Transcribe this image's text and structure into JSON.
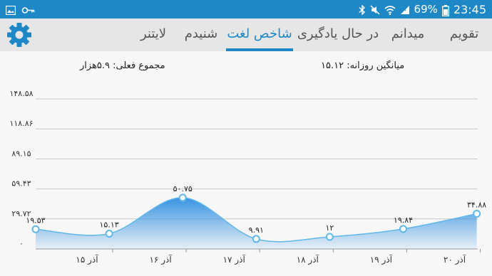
{
  "status_bar": {
    "battery": "69%",
    "time": "23:45",
    "left_icons": [
      "gallery-icon",
      "key-icon"
    ],
    "right_icons": [
      "bluetooth-icon",
      "mute-icon",
      "wifi-icon",
      "signal-icon",
      "battery-icon"
    ]
  },
  "tabs": [
    {
      "label": "تقویم",
      "active": false
    },
    {
      "label": "میدانم",
      "active": false
    },
    {
      "label": "در حال یادگیری",
      "active": false
    },
    {
      "label": "شاخص لغت",
      "active": true
    },
    {
      "label": "شنیدم",
      "active": false
    },
    {
      "label": "لایتنر",
      "active": false
    }
  ],
  "summary": {
    "daily_average": "میانگین روزانه: ۱۵.۱۲",
    "total": "مجموع فعلی: ۵.۹هزار"
  },
  "chart_data": {
    "type": "area",
    "y_ticks": [
      "۰",
      "۲۹.۷۲",
      "۵۹.۴۳",
      "۸۹.۱۵",
      "۱۱۸.۸۶",
      "۱۴۸.۵۸"
    ],
    "ylim": [
      0,
      148.58
    ],
    "grid": true,
    "x_labels": [
      "۱۵ آذر",
      "۱۶ آذر",
      "۱۷ آذر",
      "۱۸ آذر",
      "۱۹ آذر",
      "۲۰ آذر"
    ],
    "points": [
      {
        "x": 0.0,
        "y": 19.53,
        "label": "۱۹.۵۳"
      },
      {
        "x": 1.0,
        "y": 15.13,
        "label": "۱۵.۱۳"
      },
      {
        "x": 2.0,
        "y": 50.75,
        "label": "۵۰.۷۵"
      },
      {
        "x": 3.0,
        "y": 9.91,
        "label": "۹.۹۱"
      },
      {
        "x": 4.0,
        "y": 12,
        "label": "۱۲"
      },
      {
        "x": 5.0,
        "y": 19.84,
        "label": "۱۹.۸۴"
      },
      {
        "x": 6.0,
        "y": 34.88,
        "label": "۳۴.۸۸"
      }
    ],
    "series_color": "#5fb7ea",
    "fill_color": "#2f8ee0"
  }
}
